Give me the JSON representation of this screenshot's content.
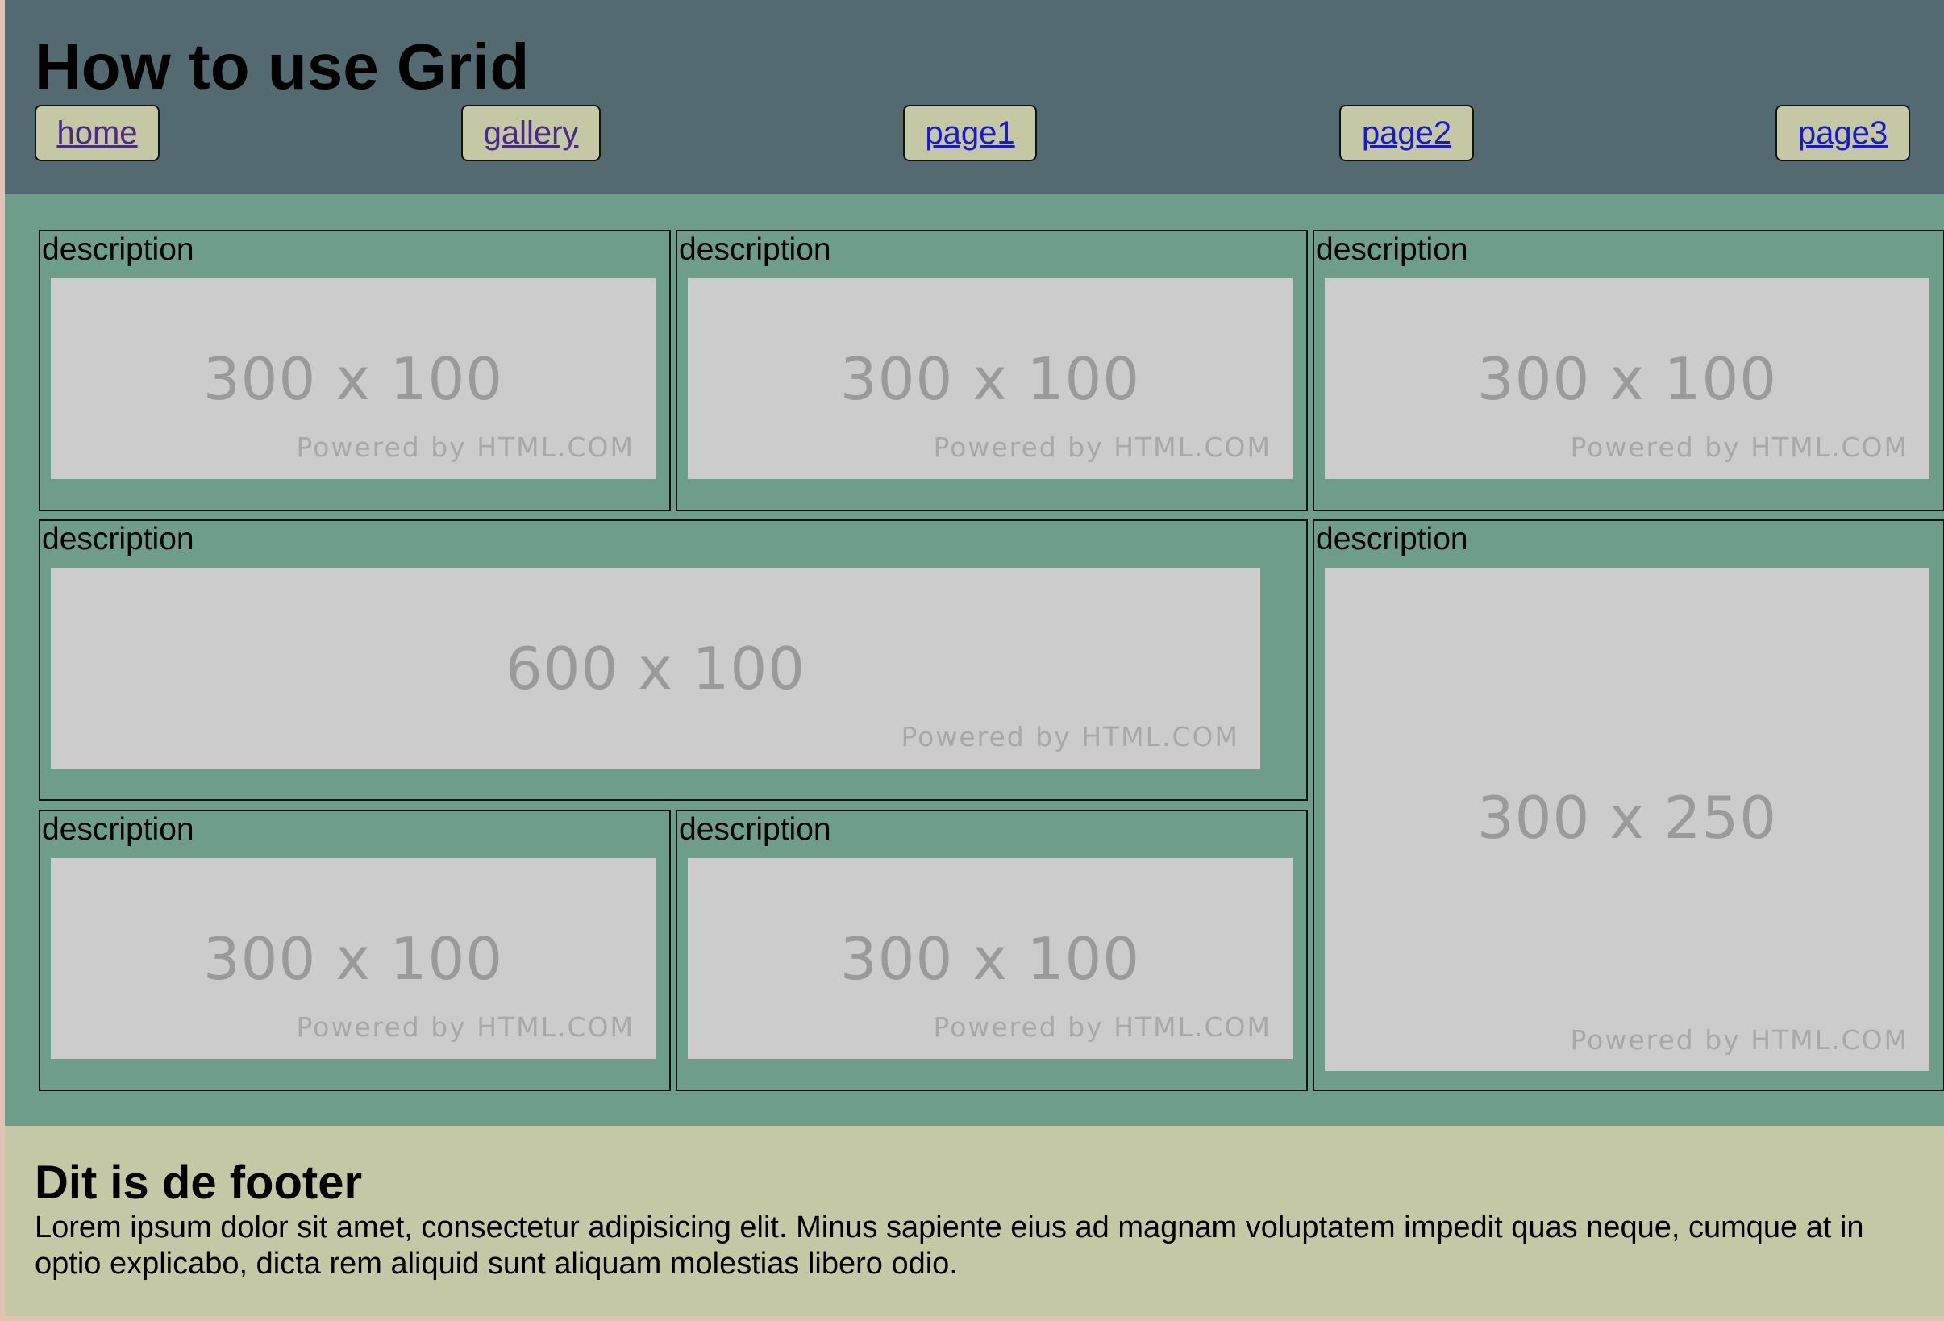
{
  "header": {
    "title": "How to use Grid",
    "nav": [
      {
        "label": "home",
        "visited": true
      },
      {
        "label": "gallery",
        "visited": true
      },
      {
        "label": "page1",
        "visited": false
      },
      {
        "label": "page2",
        "visited": false
      },
      {
        "label": "page3",
        "visited": false
      }
    ]
  },
  "gallery": {
    "cards": [
      {
        "description": "description",
        "image": {
          "dims": "300 x 100",
          "powered": "Powered by HTML.COM"
        }
      },
      {
        "description": "description",
        "image": {
          "dims": "300 x 100",
          "powered": "Powered by HTML.COM"
        }
      },
      {
        "description": "description",
        "image": {
          "dims": "300 x 100",
          "powered": "Powered by HTML.COM"
        }
      },
      {
        "description": "description",
        "image": {
          "dims": "600 x 100",
          "powered": "Powered by HTML.COM"
        }
      },
      {
        "description": "description",
        "image": {
          "dims": "300 x 250",
          "powered": "Powered by HTML.COM"
        }
      },
      {
        "description": "description",
        "image": {
          "dims": "300 x 100",
          "powered": "Powered by HTML.COM"
        }
      },
      {
        "description": "description",
        "image": {
          "dims": "300 x 100",
          "powered": "Powered by HTML.COM"
        }
      }
    ]
  },
  "footer": {
    "title": "Dit is de footer",
    "text": "Lorem ipsum dolor sit amet, consectetur adipisicing elit. Minus sapiente eius ad magnam voluptatem impedit quas neque, cumque at in optio explicabo, dicta rem aliquid sunt aliquam molestias libero odio."
  },
  "colors": {
    "header_bg": "#536b70",
    "main_bg": "#6e9e8a",
    "footer_bg": "#c5c8a4",
    "button_bg": "#c5c8a4",
    "placeholder_bg": "#cccccc",
    "link": "#1a1acc",
    "link_visited": "#4a2a86"
  }
}
